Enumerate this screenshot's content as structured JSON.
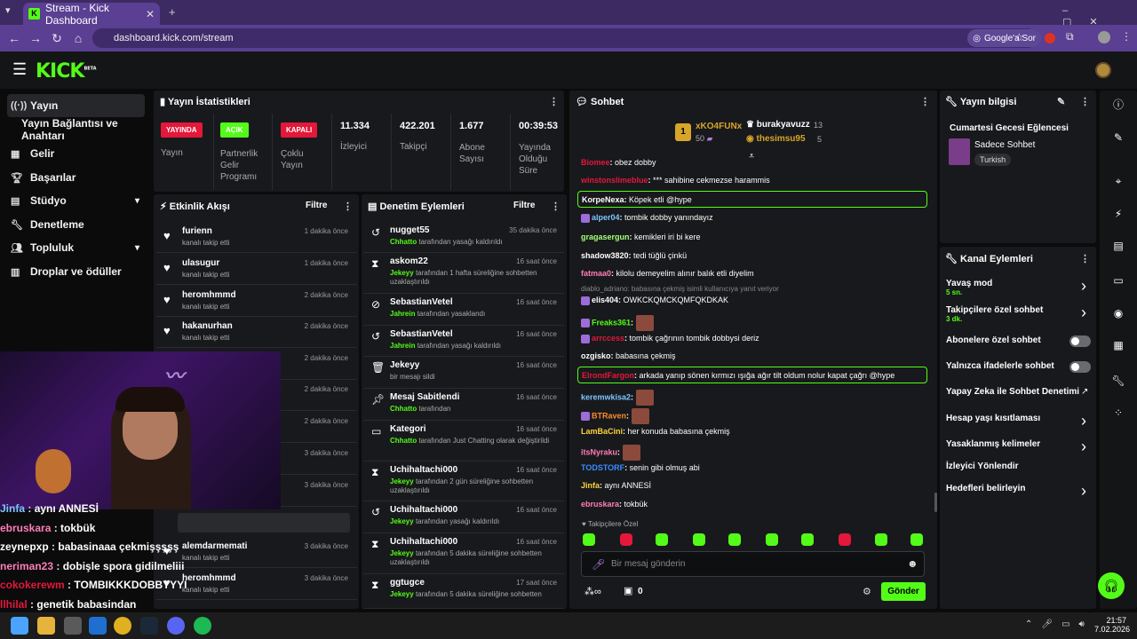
{
  "browser": {
    "tab_title": "Stream - Kick Dashboard",
    "url": "dashboard.kick.com/stream",
    "google_sor": "Google'a Sor"
  },
  "brand": {
    "logo": "KICK",
    "beta": "BETA",
    "accent": "#53fc18"
  },
  "nav": {
    "items": [
      {
        "label": "Yayın",
        "active": true,
        "icon": "broadcast-icon"
      },
      {
        "label": "Yayın Bağlantısı ve Anahtarı",
        "icon": ""
      },
      {
        "label": "Gelir",
        "icon": "revenue-icon"
      },
      {
        "label": "Başarılar",
        "icon": "trophy-icon"
      },
      {
        "label": "Stüdyo",
        "icon": "studio-icon",
        "expand": true
      },
      {
        "label": "Denetleme",
        "icon": "wrench-icon"
      },
      {
        "label": "Topluluk",
        "icon": "community-icon",
        "expand": true
      },
      {
        "label": "Droplar ve ödüller",
        "icon": "gift-icon"
      }
    ]
  },
  "stats": {
    "title": "Yayın İstatistikleri",
    "cols": [
      {
        "badge": "YAYINDA",
        "label": "Yayın",
        "color": "#e3183a"
      },
      {
        "badge": "AÇIK",
        "label": "Partnerlik Gelir Programı",
        "color": "#53fc18"
      },
      {
        "badge": "KAPALI",
        "label": "Çoklu Yayın",
        "color": "#e3183a"
      },
      {
        "value": "11.334",
        "label": "İzleyici"
      },
      {
        "value": "422.201",
        "label": "Takipçi"
      },
      {
        "value": "1.677",
        "label": "Abone Sayısı"
      },
      {
        "value": "00:39:53",
        "label": "Yayında Olduğu Süre"
      }
    ]
  },
  "activity": {
    "title": "Etkinlik Akışı",
    "filter": "Filtre",
    "rows": [
      {
        "name": "furienn",
        "sub": "kanalı takip etti",
        "time": "1 dakika önce"
      },
      {
        "name": "ulasugur",
        "sub": "kanalı takip etti",
        "time": "1 dakika önce"
      },
      {
        "name": "heromhmmd",
        "sub": "kanalı takip etti",
        "time": "2 dakika önce"
      },
      {
        "name": "hakanurhan",
        "sub": "kanalı takip etti",
        "time": "2 dakika önce"
      },
      {
        "name": "",
        "sub": "",
        "time": "2 dakika önce"
      },
      {
        "name": "",
        "sub": "",
        "time": "2 dakika önce"
      },
      {
        "name": "",
        "sub": "",
        "time": "2 dakika önce"
      },
      {
        "name": "",
        "sub": "",
        "time": "3 dakika önce"
      },
      {
        "name": "",
        "sub": "r! Toplam abonelik",
        "time": "3 dakika önce"
      },
      {
        "name": "alemdarmemati",
        "sub": "kanalı takip etti",
        "time": "3 dakika önce"
      },
      {
        "name": "heromhmmd",
        "sub": "kanalı takip etti",
        "time": "3 dakika önce"
      }
    ]
  },
  "moderation": {
    "title": "Denetim Eylemleri",
    "filter": "Filtre",
    "rows": [
      {
        "name": "nugget55",
        "who": "Chhatto",
        "text": "tarafından yasağı kaldırıldı",
        "time": "35 dakika önce",
        "icon": "undo-icon"
      },
      {
        "name": "askom22",
        "who": "Jekeyy",
        "text": "tarafından 1 hafta süreliğine sohbetten uzaklaştırıldı",
        "time": "16 saat önce",
        "icon": "hourglass-icon"
      },
      {
        "name": "SebastianVetel",
        "who": "Jahrein",
        "text": "tarafından yasaklandı",
        "time": "16 saat önce",
        "icon": "ban-icon"
      },
      {
        "name": "SebastianVetel",
        "who": "Jahrein",
        "text": "tarafından yasağı kaldırıldı",
        "time": "16 saat önce",
        "icon": "undo-icon"
      },
      {
        "name": "Jekeyy",
        "who": "",
        "text": "bir mesajı sildi",
        "time": "16 saat önce",
        "icon": "trash-icon"
      },
      {
        "name": "Mesaj Sabitlendi",
        "who": "Chhatto",
        "text": "tarafından",
        "time": "16 saat önce",
        "icon": "pin-icon"
      },
      {
        "name": "Kategori",
        "who": "Chhatto",
        "text": "tarafından Just Chatting olarak değiştirildi",
        "time": "16 saat önce",
        "icon": "category-icon"
      },
      {
        "name": "Uchihaltachi000",
        "who": "Jekeyy",
        "text": "tarafından 2 gün süreliğine sohbetten uzaklaştırıldı",
        "time": "16 saat önce",
        "icon": "hourglass-icon"
      },
      {
        "name": "Uchihaltachi000",
        "who": "Jekeyy",
        "text": "tarafından yasağı kaldırıldı",
        "time": "16 saat önce",
        "icon": "undo-icon"
      },
      {
        "name": "Uchihaltachi000",
        "who": "Jekeyy",
        "text": "tarafından 5 dakika süreliğine sohbetten uzaklaştırıldı",
        "time": "16 saat önce",
        "icon": "hourglass-icon"
      },
      {
        "name": "ggtugce",
        "who": "Jekeyy",
        "text": "tarafından 5 dakika süreliğine sohbetten",
        "time": "17 saat önce",
        "icon": "hourglass-icon"
      }
    ]
  },
  "chat": {
    "title": "Sohbet",
    "top": [
      {
        "rank": "1",
        "name": "xKO4FUNx",
        "val": "50"
      },
      {
        "name": "burakyavuzz",
        "val": "13"
      },
      {
        "name": "thesimsu95",
        "val": "5"
      }
    ],
    "messages": [
      {
        "user": "Biomee",
        "color": "#e3183a",
        "text": "obez dobby"
      },
      {
        "user": "winstonslimeblue",
        "color": "#e3183a",
        "text": "*** sahibine cekmezse harammis"
      },
      {
        "user": "KorpeNexa",
        "color": "#ffffff",
        "text": "Köpek etli @hype",
        "hl": true
      },
      {
        "user": "alper04",
        "color": "#7cc6ff",
        "text": "tombik dobby yanındayız"
      },
      {
        "user": "gragasergun",
        "color": "#a4ff79",
        "text": "kemikleri iri bi kere"
      },
      {
        "user": "shadow3820",
        "color": "#ffffff",
        "text": "tedi tüğlü çinkü"
      },
      {
        "user": "fatmaa0",
        "color": "#ff7db7",
        "text": "kilolu demeyelim alınır balık etli diyelim"
      },
      {
        "user": "elis404",
        "color": "#ffffff",
        "text": "OWKCKQMCKQMFQKDKAK",
        "reply": "diablo_adriano: babasına çekmiş isimli kullanıcıya yanıt veriyor"
      },
      {
        "user": "Freaks361",
        "color": "#53fc18",
        "text": ""
      },
      {
        "user": "arrccess",
        "color": "#e3183a",
        "text": "tombik çağrının tombik dobbysi deriz"
      },
      {
        "user": "ozgisko",
        "color": "#ffffff",
        "text": "babasına çekmiş"
      },
      {
        "user": "ElrondFargon",
        "color": "#e3183a",
        "text": "arkada yanıp sönen kırmızı ışığa ağır tilt oldum nolur kapat çağrı @hype",
        "hl": true
      },
      {
        "user": "keremwkisa2",
        "color": "#7cc6ff",
        "text": ""
      },
      {
        "user": "BTRaven",
        "color": "#ff8a2a",
        "text": ""
      },
      {
        "user": "LamBaCini",
        "color": "#ffd33a",
        "text": "her konuda babasına çekmiş"
      },
      {
        "user": "itsNyraku",
        "color": "#ff7db7",
        "text": ""
      },
      {
        "user": "TODSTORF",
        "color": "#3b8bff",
        "text": "senin gibi olmuş abi"
      },
      {
        "user": "Jinfa",
        "color": "#ffd33a",
        "text": "aynı ANNESİ"
      },
      {
        "user": "ebruskara",
        "color": "#ff7db7",
        "text": "tokbük"
      }
    ],
    "followers_only": "Takipçilere Özel",
    "placeholder": "Bir mesaj gönderin",
    "send": "Gönder",
    "count": "0"
  },
  "info": {
    "title": "Yayın bilgisi",
    "stream_title": "Cumartesi Gecesi Eğlencesi",
    "category": "Sadece Sohbet",
    "tag": "Turkish"
  },
  "actions": {
    "title": "Kanal Eylemleri",
    "items": [
      {
        "label": "Yavaş mod",
        "sub": "5 sn.",
        "type": "chev"
      },
      {
        "label": "Takipçilere özel sohbet",
        "sub": "3 dk.",
        "type": "chev"
      },
      {
        "label": "Abonelere özel sohbet",
        "type": "toggle"
      },
      {
        "label": "Yalnızca ifadelerle sohbet",
        "type": "toggle"
      },
      {
        "label": "Yapay Zeka ile Sohbet Denetimi",
        "type": "ext"
      },
      {
        "label": "Hesap yaşı kısıtlaması",
        "type": "chev"
      },
      {
        "label": "Yasaklanmış kelimeler",
        "type": "chev"
      },
      {
        "label": "İzleyici Yönlendir",
        "type": "none"
      },
      {
        "label": "Hedefleri belirleyin",
        "type": "chev"
      }
    ]
  },
  "overlay": [
    {
      "user": "Jinfa",
      "text": "aynı ANNESİ",
      "color": "#7cc6ff"
    },
    {
      "user": "ebruskara",
      "text": "tokbük",
      "color": "#ff7db7"
    },
    {
      "user": "zeynepxp",
      "text": "babasinaaa çekmişşşşş",
      "color": "#ffffff"
    },
    {
      "user": "neriman23",
      "text": "dobişle spora gidilmeliii",
      "color": "#ff7db7"
    },
    {
      "user": "cokokerewm",
      "text": "TOMBIKKKDOBBYYYI",
      "color": "#e3183a"
    },
    {
      "user": "llhilal",
      "text": "genetik babasindan",
      "color": "#e3183a"
    }
  ],
  "taskbar": {
    "time": "21:57",
    "date": "7.02.2026"
  }
}
